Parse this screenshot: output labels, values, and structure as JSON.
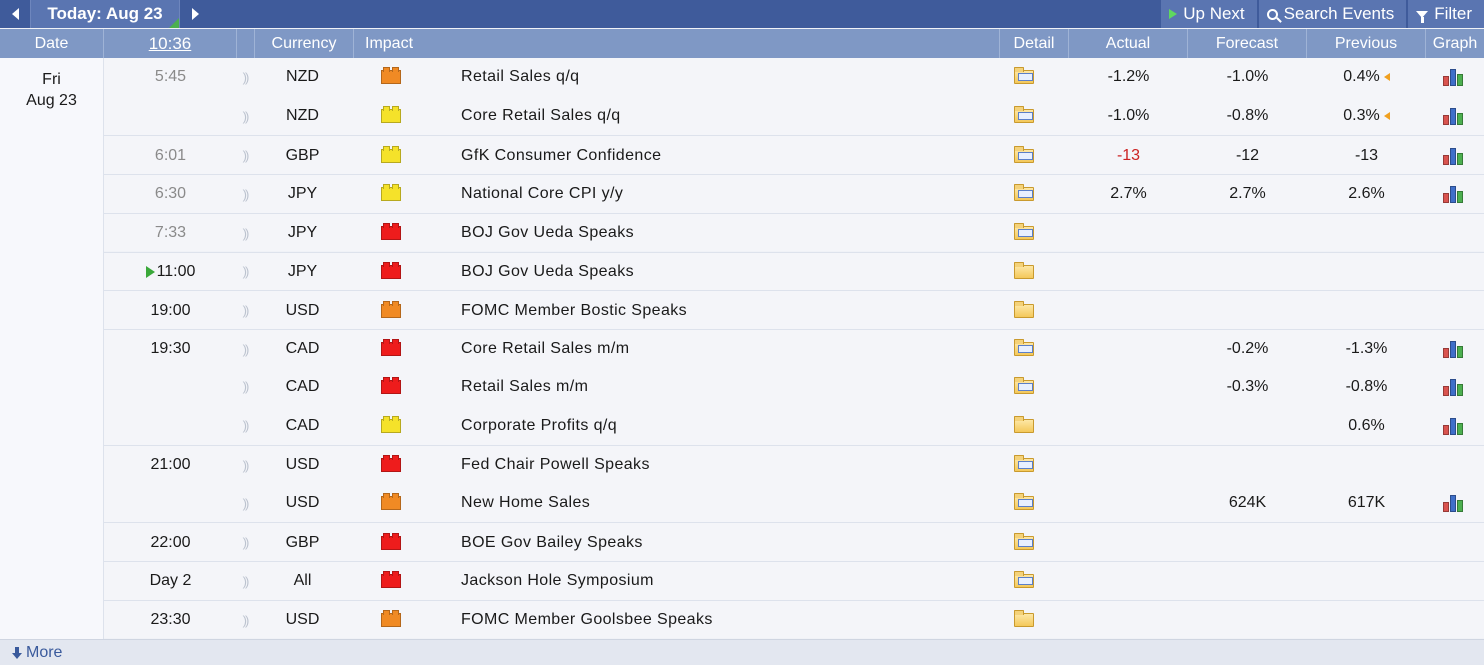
{
  "topbar": {
    "today_label": "Today: Aug 23",
    "up_next_label": "Up Next",
    "search_label": "Search Events",
    "filter_label": "Filter"
  },
  "header": {
    "date": "Date",
    "time": "10:36",
    "currency": "Currency",
    "impact": "Impact",
    "detail": "Detail",
    "actual": "Actual",
    "forecast": "Forecast",
    "previous": "Previous",
    "graph": "Graph"
  },
  "date_cell": {
    "weekday": "Fri",
    "date": "Aug 23"
  },
  "impact_colors": {
    "high": "#ee1c1c",
    "medium": "#f08a24",
    "low": "#f5e22a"
  },
  "events": [
    {
      "time": "5:45",
      "past": true,
      "currency": "NZD",
      "impact": "medium",
      "event": "Retail Sales q/q",
      "detail_icon": "folder-blue",
      "actual": "-1.2%",
      "actual_bad": false,
      "forecast": "-1.0%",
      "previous": "0.4%",
      "revised": true,
      "graph": true
    },
    {
      "time": "",
      "past": true,
      "currency": "NZD",
      "impact": "low",
      "event": "Core Retail Sales q/q",
      "detail_icon": "folder-blue",
      "actual": "-1.0%",
      "actual_bad": false,
      "forecast": "-0.8%",
      "previous": "0.3%",
      "revised": true,
      "graph": true
    },
    {
      "time": "6:01",
      "past": true,
      "currency": "GBP",
      "impact": "low",
      "event": "GfK Consumer Confidence",
      "detail_icon": "folder-blue",
      "actual": "-13",
      "actual_bad": true,
      "forecast": "-12",
      "previous": "-13",
      "revised": false,
      "graph": true
    },
    {
      "time": "6:30",
      "past": true,
      "currency": "JPY",
      "impact": "low",
      "event": "National Core CPI y/y",
      "detail_icon": "folder-blue",
      "actual": "2.7%",
      "actual_bad": false,
      "forecast": "2.7%",
      "previous": "2.6%",
      "revised": false,
      "graph": true
    },
    {
      "time": "7:33",
      "past": true,
      "currency": "JPY",
      "impact": "high",
      "event": "BOJ Gov Ueda Speaks",
      "detail_icon": "folder-blue",
      "actual": "",
      "actual_bad": false,
      "forecast": "",
      "previous": "",
      "revised": false,
      "graph": false
    },
    {
      "time": "11:00",
      "past": false,
      "current": true,
      "currency": "JPY",
      "impact": "high",
      "event": "BOJ Gov Ueda Speaks",
      "detail_icon": "folder",
      "actual": "",
      "actual_bad": false,
      "forecast": "",
      "previous": "",
      "revised": false,
      "graph": false
    },
    {
      "time": "19:00",
      "past": false,
      "currency": "USD",
      "impact": "medium",
      "event": "FOMC Member Bostic Speaks",
      "detail_icon": "folder",
      "actual": "",
      "actual_bad": false,
      "forecast": "",
      "previous": "",
      "revised": false,
      "graph": false
    },
    {
      "time": "19:30",
      "past": false,
      "currency": "CAD",
      "impact": "high",
      "event": "Core Retail Sales m/m",
      "detail_icon": "folder-blue",
      "actual": "",
      "actual_bad": false,
      "forecast": "-0.2%",
      "previous": "-1.3%",
      "revised": false,
      "graph": true
    },
    {
      "time": "",
      "past": false,
      "currency": "CAD",
      "impact": "high",
      "event": "Retail Sales m/m",
      "detail_icon": "folder-blue",
      "actual": "",
      "actual_bad": false,
      "forecast": "-0.3%",
      "previous": "-0.8%",
      "revised": false,
      "graph": true
    },
    {
      "time": "",
      "past": false,
      "currency": "CAD",
      "impact": "low",
      "event": "Corporate Profits q/q",
      "detail_icon": "folder",
      "actual": "",
      "actual_bad": false,
      "forecast": "",
      "previous": "0.6%",
      "revised": false,
      "graph": true
    },
    {
      "time": "21:00",
      "past": false,
      "currency": "USD",
      "impact": "high",
      "event": "Fed Chair Powell Speaks",
      "detail_icon": "folder-blue",
      "actual": "",
      "actual_bad": false,
      "forecast": "",
      "previous": "",
      "revised": false,
      "graph": false
    },
    {
      "time": "",
      "past": false,
      "currency": "USD",
      "impact": "medium",
      "event": "New Home Sales",
      "detail_icon": "folder-blue",
      "actual": "",
      "actual_bad": false,
      "forecast": "624K",
      "previous": "617K",
      "revised": false,
      "graph": true
    },
    {
      "time": "22:00",
      "past": false,
      "currency": "GBP",
      "impact": "high",
      "event": "BOE Gov Bailey Speaks",
      "detail_icon": "folder-blue",
      "actual": "",
      "actual_bad": false,
      "forecast": "",
      "previous": "",
      "revised": false,
      "graph": false
    },
    {
      "time": "Day 2",
      "past": false,
      "currency": "All",
      "impact": "high",
      "event": "Jackson Hole Symposium",
      "detail_icon": "folder-blue",
      "actual": "",
      "actual_bad": false,
      "forecast": "",
      "previous": "",
      "revised": false,
      "graph": false
    },
    {
      "time": "23:30",
      "past": false,
      "currency": "USD",
      "impact": "medium",
      "event": "FOMC Member Goolsbee Speaks",
      "detail_icon": "folder",
      "actual": "",
      "actual_bad": false,
      "forecast": "",
      "previous": "",
      "revised": false,
      "graph": false
    }
  ],
  "footer": {
    "more_label": "More"
  }
}
